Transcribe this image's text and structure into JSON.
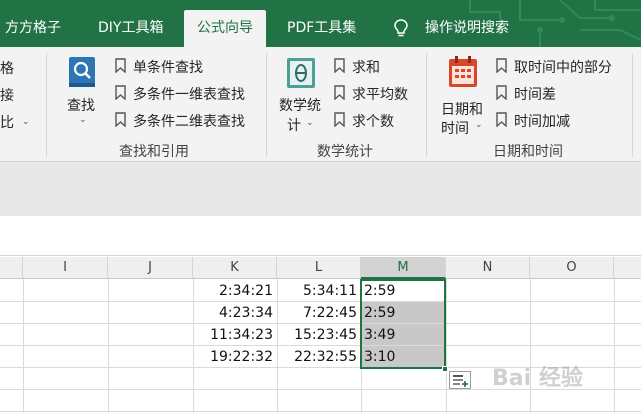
{
  "tabs": [
    {
      "label": "方方格子"
    },
    {
      "label": "DIY工具箱"
    },
    {
      "label": "公式向导"
    },
    {
      "label": "PDF工具集"
    },
    {
      "label": "操作说明搜索"
    }
  ],
  "ribbon": {
    "left_partial": [
      "格",
      "接",
      "比"
    ],
    "lookup": {
      "big_button": "查找",
      "items": [
        "单条件查找",
        "多条件一维表查找",
        "多条件二维表查找"
      ],
      "group_label": "查找和引用"
    },
    "stats": {
      "big_button_line1": "数学统",
      "big_button_line2": "计",
      "items": [
        "求和",
        "求平均数",
        "求个数"
      ],
      "group_label": "数学统计"
    },
    "datetime": {
      "big_button_line1": "日期和",
      "big_button_line2": "时间",
      "items": [
        "取时间中的部分",
        "时间差",
        "时间加减"
      ],
      "group_label": "日期和时间"
    }
  },
  "columns": [
    "I",
    "J",
    "K",
    "L",
    "M",
    "N",
    "O"
  ],
  "rows": [
    {
      "K": "2:34:21",
      "L": "5:34:11",
      "M": "2:59"
    },
    {
      "K": "4:23:34",
      "L": "7:22:45",
      "M": "2:59"
    },
    {
      "K": "11:34:23",
      "L": "15:23:45",
      "M": "3:49"
    },
    {
      "K": "19:22:32",
      "L": "22:32:55",
      "M": "3:10"
    }
  ],
  "watermark": "Bai 经验",
  "colors": {
    "accent": "#217346",
    "selection": "#c8c8c8"
  }
}
